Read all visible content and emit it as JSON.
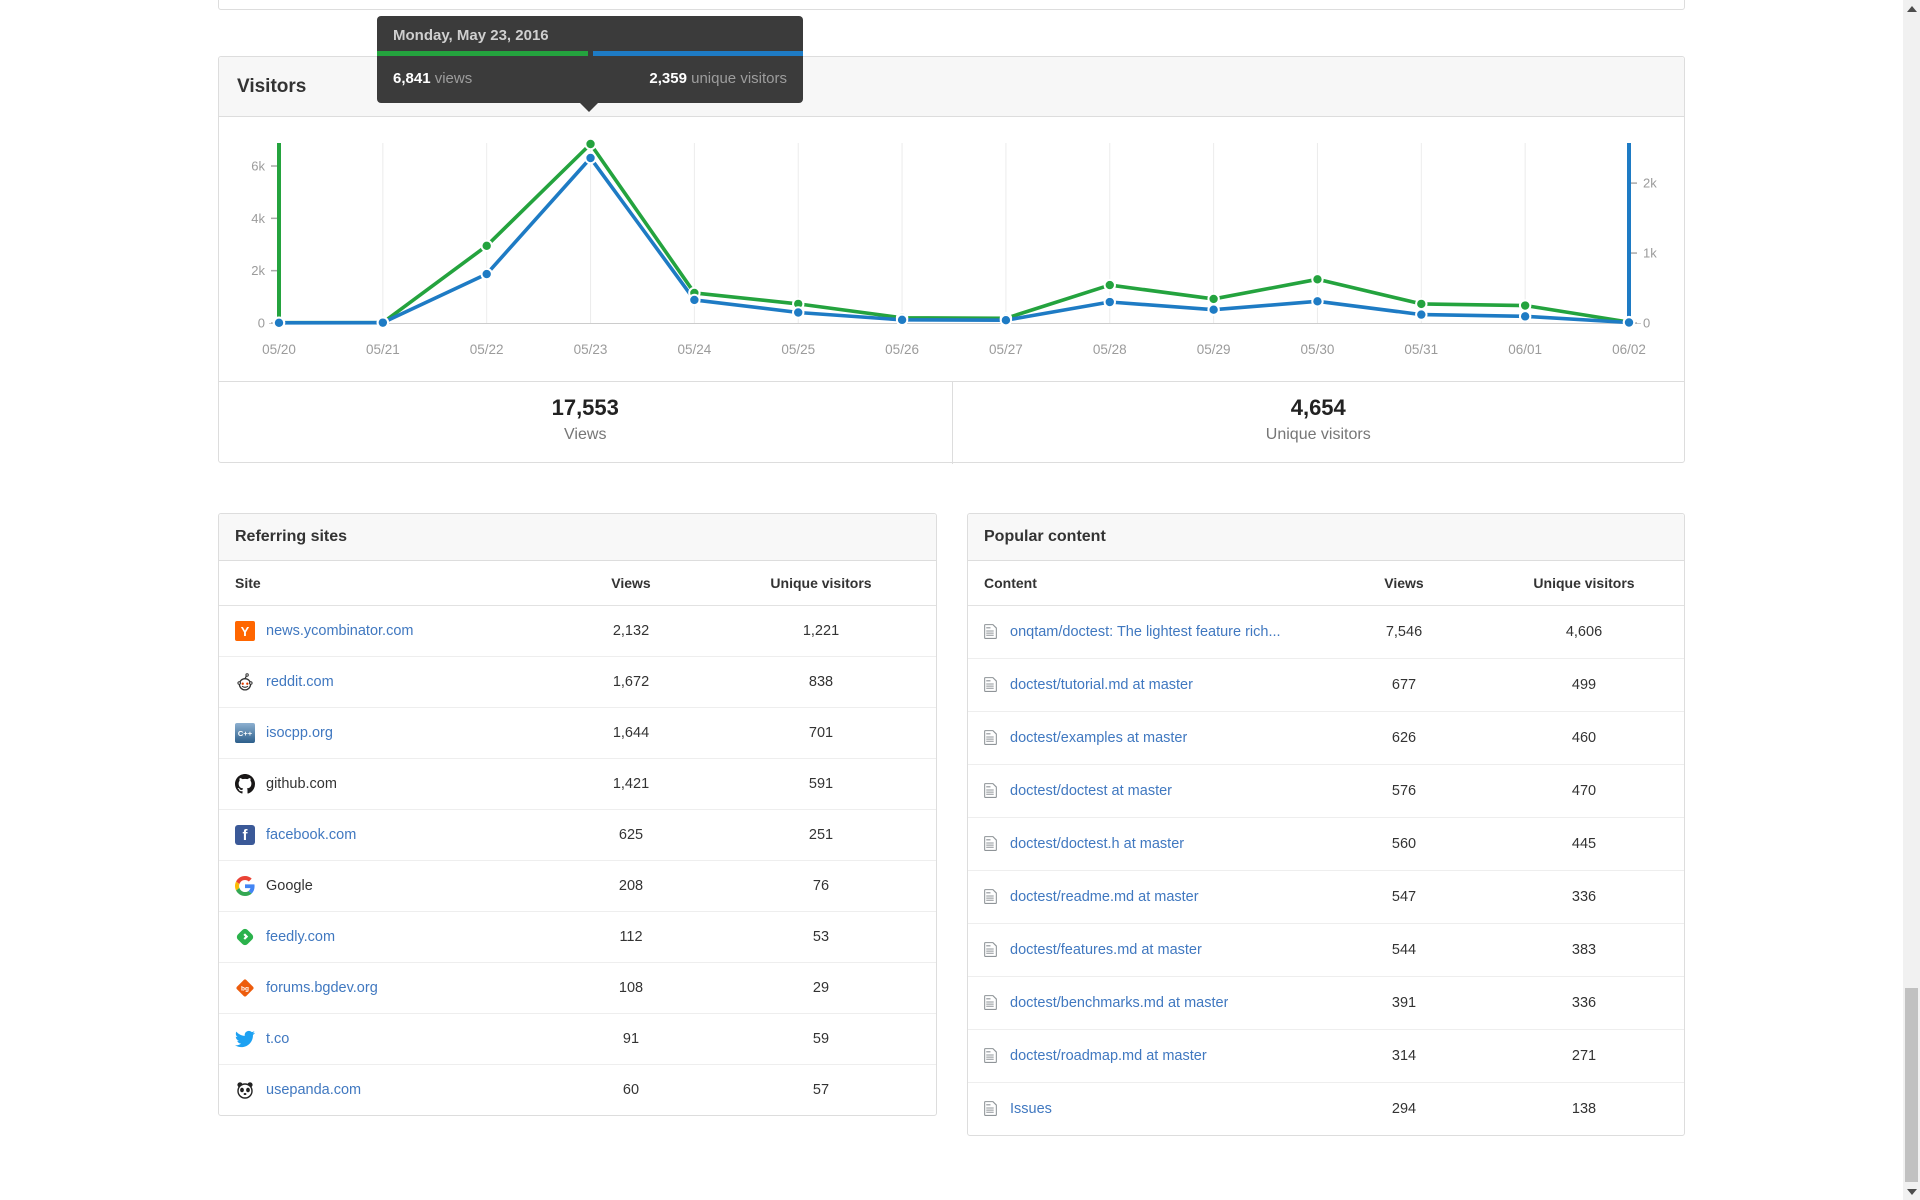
{
  "visitors_panel": {
    "title": "Visitors",
    "summary": {
      "views_value": "17,553",
      "views_label": "Views",
      "unique_value": "4,654",
      "unique_label": "Unique visitors"
    }
  },
  "tooltip": {
    "date": "Monday, May 23, 2016",
    "views_value": "6,841",
    "views_label": "views",
    "unique_value": "2,359",
    "unique_label": "unique visitors"
  },
  "chart_data": {
    "type": "line",
    "title": "Visitors",
    "x": [
      "05/20",
      "05/21",
      "05/22",
      "05/23",
      "05/24",
      "05/25",
      "05/26",
      "05/27",
      "05/28",
      "05/29",
      "05/30",
      "05/31",
      "06/01",
      "06/02"
    ],
    "series": [
      {
        "name": "views",
        "color": "#24a33e",
        "axis": "left",
        "values": [
          12,
          18,
          2950,
          6841,
          1150,
          730,
          200,
          180,
          1450,
          920,
          1670,
          730,
          668,
          34
        ]
      },
      {
        "name": "unique visitors",
        "color": "#1e7bc4",
        "axis": "right",
        "values": [
          3,
          5,
          700,
          2359,
          330,
          150,
          45,
          40,
          300,
          190,
          310,
          120,
          95,
          7
        ]
      }
    ],
    "left_axis": {
      "max": 6841,
      "tick_values": [
        0,
        2000,
        4000,
        6000
      ],
      "tick_labels": [
        "0",
        "2k",
        "4k",
        "6k"
      ]
    },
    "right_axis": {
      "max": 2359,
      "tick_values": [
        0,
        1000,
        2000
      ],
      "tick_labels": [
        "0",
        "1k",
        "2k"
      ]
    },
    "grid": true,
    "legend": "none",
    "totals": {
      "views": 17553,
      "unique_visitors": 4654
    },
    "highlighted_point": {
      "date": "05/23",
      "views": 6841,
      "unique_visitors": 2359
    }
  },
  "referring_sites": {
    "title": "Referring sites",
    "columns": [
      "Site",
      "Views",
      "Unique visitors"
    ],
    "rows": [
      {
        "site": "news.ycombinator.com",
        "icon": "ycombinator",
        "link": true,
        "views": "2,132",
        "unique": "1,221"
      },
      {
        "site": "reddit.com",
        "icon": "reddit",
        "link": true,
        "views": "1,672",
        "unique": "838"
      },
      {
        "site": "isocpp.org",
        "icon": "isocpp",
        "link": true,
        "views": "1,644",
        "unique": "701"
      },
      {
        "site": "github.com",
        "icon": "github",
        "link": false,
        "views": "1,421",
        "unique": "591"
      },
      {
        "site": "facebook.com",
        "icon": "facebook",
        "link": true,
        "views": "625",
        "unique": "251"
      },
      {
        "site": "Google",
        "icon": "google",
        "link": false,
        "views": "208",
        "unique": "76"
      },
      {
        "site": "feedly.com",
        "icon": "feedly",
        "link": true,
        "views": "112",
        "unique": "53"
      },
      {
        "site": "forums.bgdev.org",
        "icon": "bgdev",
        "link": true,
        "views": "108",
        "unique": "29"
      },
      {
        "site": "t.co",
        "icon": "twitter",
        "link": true,
        "views": "91",
        "unique": "59"
      },
      {
        "site": "usepanda.com",
        "icon": "panda",
        "link": true,
        "views": "60",
        "unique": "57"
      }
    ]
  },
  "popular_content": {
    "title": "Popular content",
    "columns": [
      "Content",
      "Views",
      "Unique visitors"
    ],
    "rows": [
      {
        "content": "onqtam/doctest: The lightest feature rich...",
        "views": "7,546",
        "unique": "4,606"
      },
      {
        "content": "doctest/tutorial.md at master",
        "views": "677",
        "unique": "499"
      },
      {
        "content": "doctest/examples at master",
        "views": "626",
        "unique": "460"
      },
      {
        "content": "doctest/doctest at master",
        "views": "576",
        "unique": "470"
      },
      {
        "content": "doctest/doctest.h at master",
        "views": "560",
        "unique": "445"
      },
      {
        "content": "doctest/readme.md at master",
        "views": "547",
        "unique": "336"
      },
      {
        "content": "doctest/features.md at master",
        "views": "544",
        "unique": "383"
      },
      {
        "content": "doctest/benchmarks.md at master",
        "views": "391",
        "unique": "336"
      },
      {
        "content": "doctest/roadmap.md at master",
        "views": "314",
        "unique": "271"
      },
      {
        "content": "Issues",
        "views": "294",
        "unique": "138"
      }
    ]
  },
  "icons": {
    "ycombinator_glyph": "Y",
    "isocpp_glyph": "C++",
    "facebook_glyph": "f",
    "bgdev_glyph": "bg"
  },
  "colors": {
    "views_green": "#24a33e",
    "unique_blue": "#1e7bc4",
    "link_blue": "#4078c0"
  }
}
